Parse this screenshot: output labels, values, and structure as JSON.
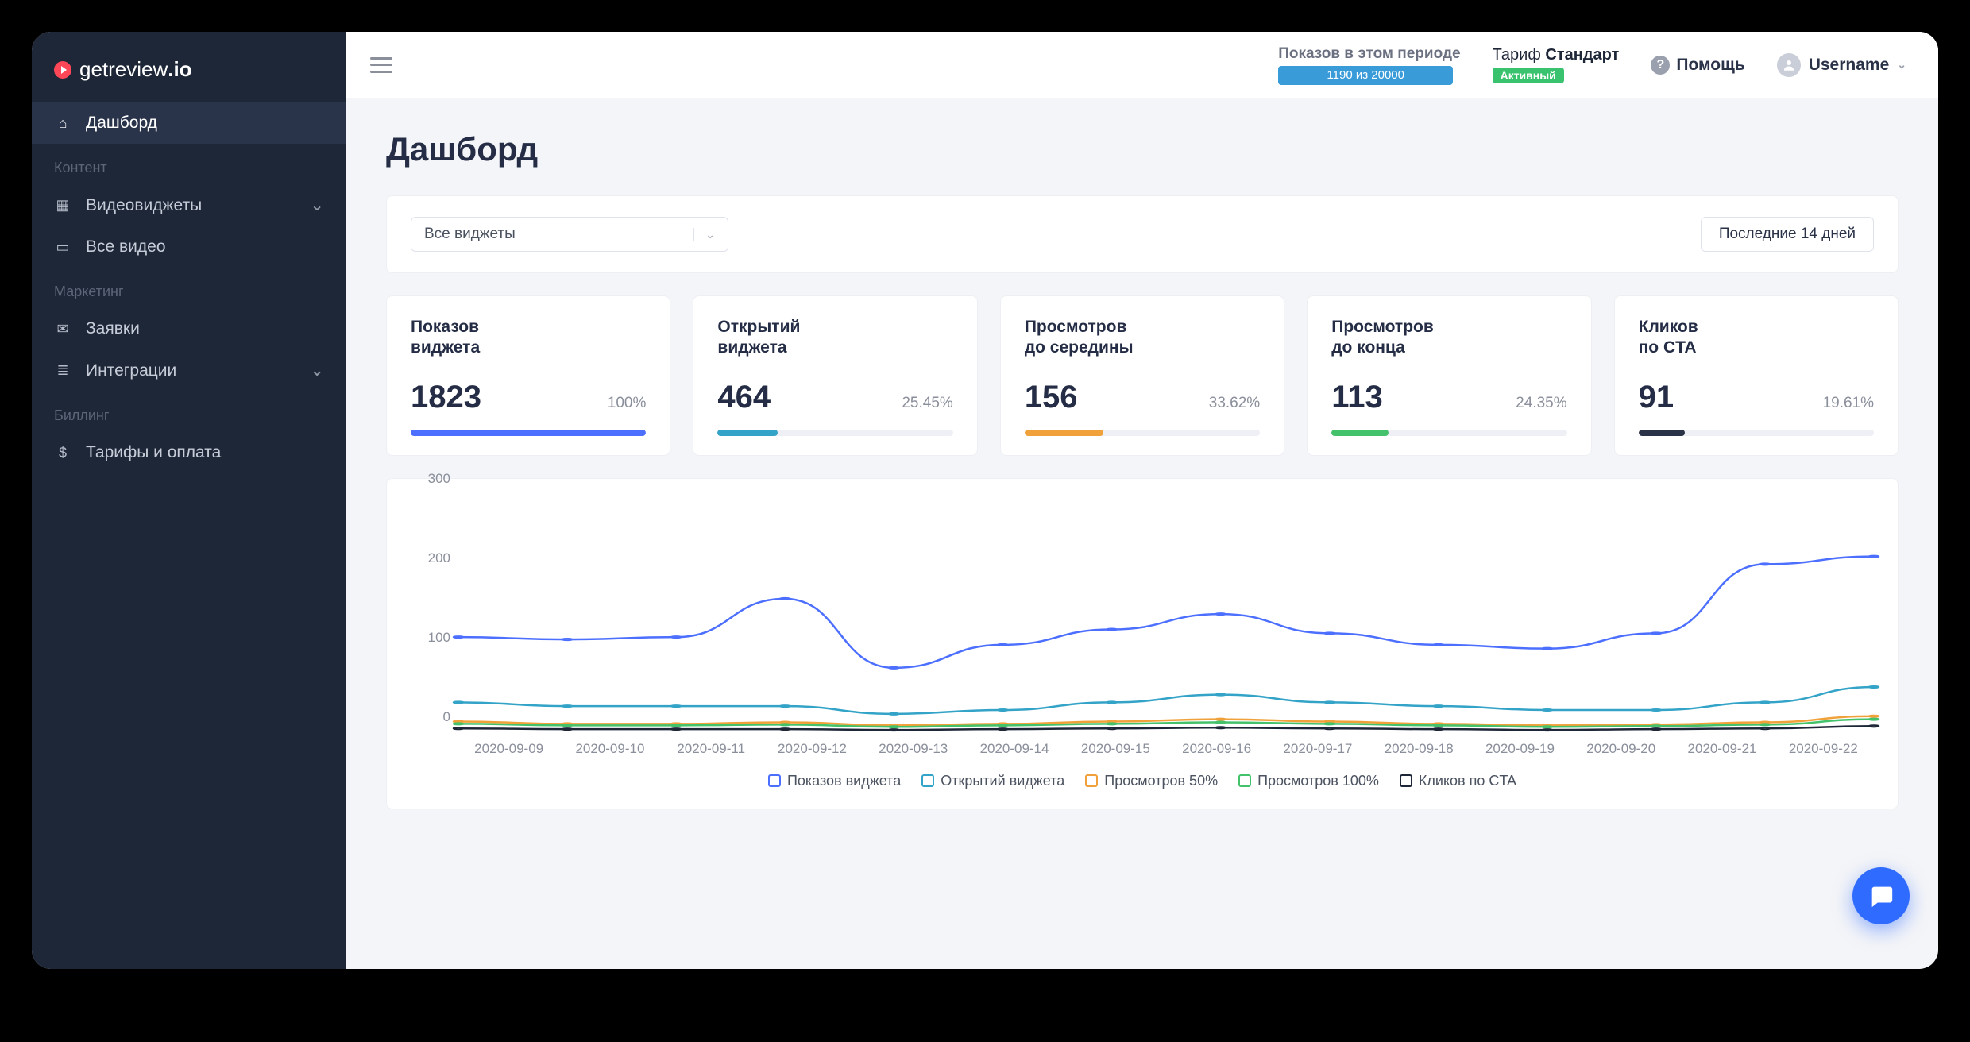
{
  "brand": {
    "name": "getreview",
    "suffix": ".io"
  },
  "sidebar": {
    "items": [
      {
        "label": "Дашборд",
        "icon": "home-icon",
        "active": true
      },
      {
        "group": "Контент"
      },
      {
        "label": "Видеовиджеты",
        "icon": "widget-icon",
        "chevron": true
      },
      {
        "label": "Все видео",
        "icon": "video-icon"
      },
      {
        "group": "Маркетинг"
      },
      {
        "label": "Заявки",
        "icon": "inbox-icon"
      },
      {
        "label": "Интеграции",
        "icon": "layers-icon",
        "chevron": true
      },
      {
        "group": "Биллинг"
      },
      {
        "label": "Тарифы и оплата",
        "icon": "dollar-icon"
      }
    ]
  },
  "topbar": {
    "period_label": "Показов в этом периоде",
    "period_value": "1190 из 20000",
    "tariff_prefix": "Тариф ",
    "tariff_name": "Стандарт",
    "tariff_badge": "Активный",
    "help": "Помощь",
    "username": "Username"
  },
  "page": {
    "title": "Дашборд"
  },
  "filters": {
    "widget_select": "Все виджеты",
    "date_range": "Последние 14 дней"
  },
  "stats": [
    {
      "title": "Показов\nвиджета",
      "value": "1823",
      "pct": "100%",
      "pct_num": 100,
      "color": "#4c6fff"
    },
    {
      "title": "Открытий\nвиджета",
      "value": "464",
      "pct": "25.45%",
      "pct_num": 25.45,
      "color": "#33a3c7"
    },
    {
      "title": "Просмотров\nдо середины",
      "value": "156",
      "pct": "33.62%",
      "pct_num": 33.62,
      "color": "#f0a13a"
    },
    {
      "title": "Просмотров\nдо конца",
      "value": "113",
      "pct": "24.35%",
      "pct_num": 24.35,
      "color": "#44c26b"
    },
    {
      "title": "Кликов\nпо CTA",
      "value": "91",
      "pct": "19.61%",
      "pct_num": 19.61,
      "color": "#2a3248"
    }
  ],
  "chart_data": {
    "type": "line",
    "title": "",
    "xlabel": "",
    "ylabel": "",
    "ylim": [
      0,
      300
    ],
    "yticks": [
      0,
      100,
      200,
      300
    ],
    "categories": [
      "2020-09-09",
      "2020-09-10",
      "2020-09-11",
      "2020-09-12",
      "2020-09-13",
      "2020-09-14",
      "2020-09-15",
      "2020-09-16",
      "2020-09-17",
      "2020-09-18",
      "2020-09-19",
      "2020-09-20",
      "2020-09-21",
      "2020-09-22"
    ],
    "series": [
      {
        "name": "Показов виджета",
        "color": "#4c6fff",
        "values": [
          125,
          122,
          125,
          175,
          85,
          115,
          135,
          155,
          130,
          115,
          110,
          130,
          220,
          230
        ]
      },
      {
        "name": "Открытий виджета",
        "color": "#33a3c7",
        "values": [
          40,
          35,
          35,
          35,
          25,
          30,
          40,
          50,
          40,
          35,
          30,
          30,
          40,
          60
        ]
      },
      {
        "name": "Просмотров 50%",
        "color": "#f0a13a",
        "values": [
          15,
          12,
          12,
          14,
          10,
          12,
          15,
          18,
          15,
          12,
          10,
          11,
          14,
          22
        ]
      },
      {
        "name": "Просмотров 100%",
        "color": "#44c26b",
        "values": [
          12,
          10,
          10,
          11,
          8,
          10,
          12,
          14,
          12,
          10,
          8,
          9,
          11,
          18
        ]
      },
      {
        "name": "Кликов по CTA",
        "color": "#1e2738",
        "values": [
          6,
          5,
          5,
          5,
          4,
          5,
          6,
          7,
          6,
          5,
          4,
          5,
          6,
          9
        ]
      }
    ]
  },
  "legend": [
    {
      "label": "Показов виджета",
      "color": "#4c6fff"
    },
    {
      "label": "Открытий виджета",
      "color": "#33a3c7"
    },
    {
      "label": "Просмотров 50%",
      "color": "#f0a13a"
    },
    {
      "label": "Просмотров 100%",
      "color": "#44c26b"
    },
    {
      "label": "Кликов по CTA",
      "color": "#1e2738"
    }
  ]
}
